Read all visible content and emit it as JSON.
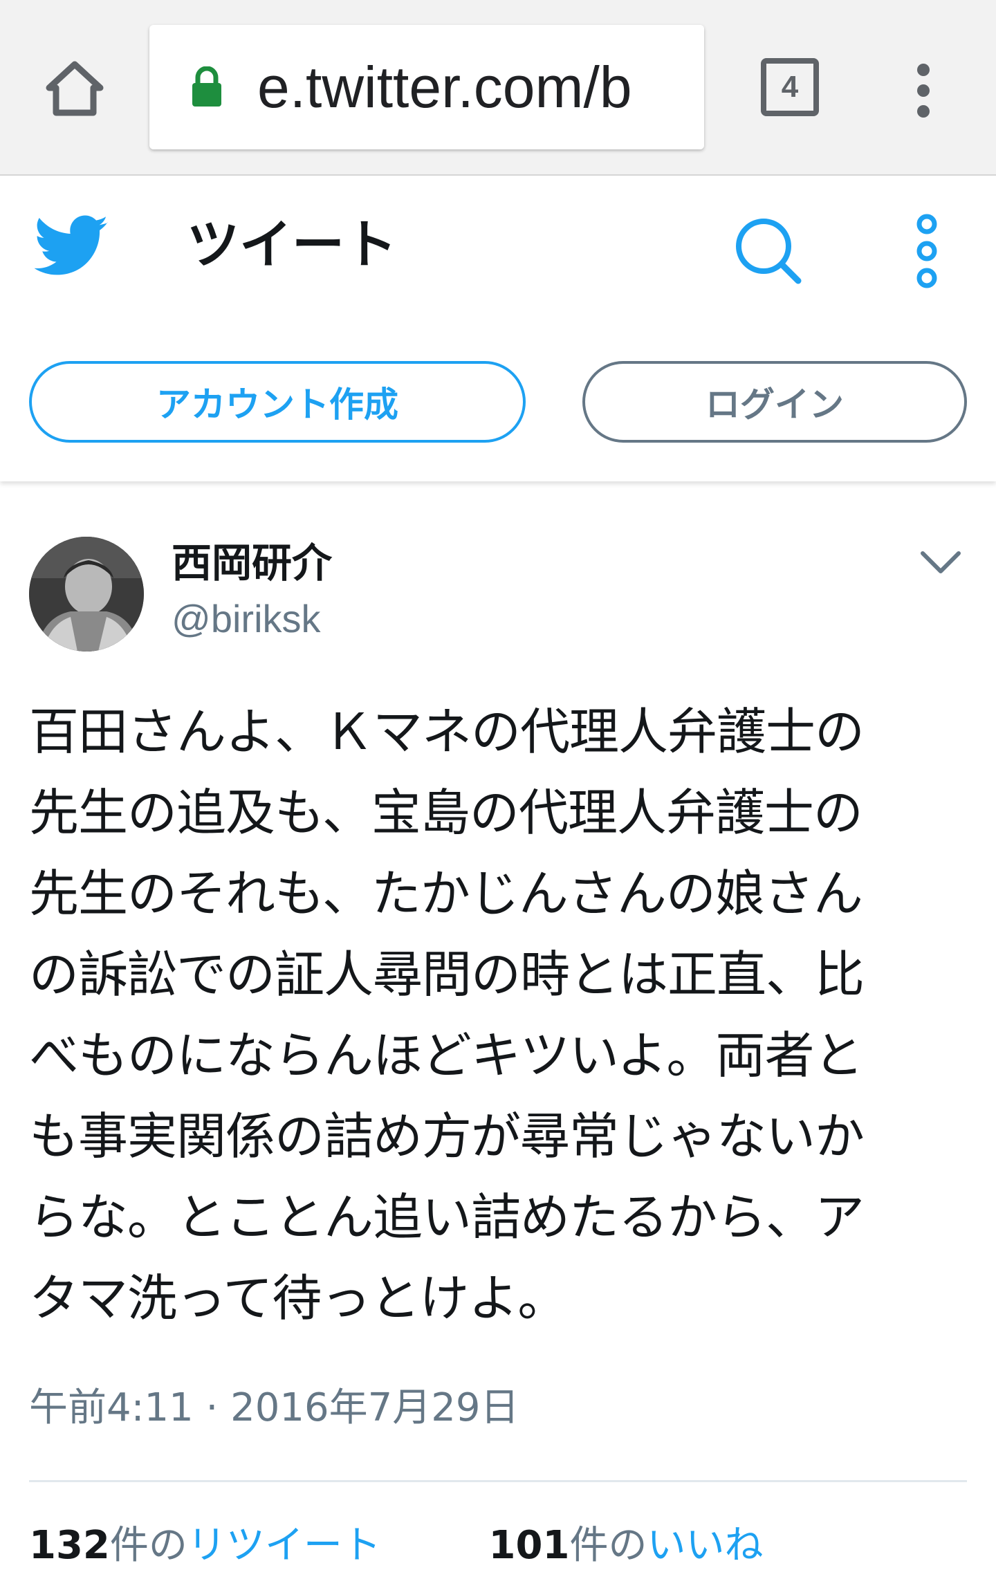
{
  "browser": {
    "url": "e.twitter.com/b",
    "tab_count": "4",
    "home_icon": "home-icon",
    "lock_icon": "lock-icon",
    "menu_icon": "vertical-dots-icon",
    "colors": {
      "lock": "#1e8e3e",
      "chrome_bg": "#f2f2f2",
      "icon": "#5f6368"
    }
  },
  "header": {
    "title": "ツイート",
    "logo_icon": "twitter-bird-icon",
    "search_icon": "search-icon",
    "more_icon": "more-dots-icon",
    "signup_label": "アカウント作成",
    "login_label": "ログイン",
    "colors": {
      "accent": "#1da1f2",
      "secondary": "#657786"
    }
  },
  "tweet": {
    "author_name": "西岡研介",
    "author_handle": "@biriksk",
    "text": "百田さんよ、Ｋマネの代理人弁護士の\n先生の追及も、宝島の代理人弁護士の\n先生のそれも、たかじんさんの娘さん\nの訴訟での証人尋問の時とは正直、比\nべものにならんほどキツいよ。両者と\nも事実関係の詰め方が尋常じゃないか\nらな。とことん追い詰めたるから、ア\nタマ洗って待っとけよ。",
    "timestamp": "午前4:11 · 2016年7月29日",
    "retweet_count": "132",
    "retweet_label_prefix": "件の",
    "retweet_label": "リツイート",
    "like_count": "101",
    "like_label_prefix": "件の",
    "like_label": "いいね"
  }
}
